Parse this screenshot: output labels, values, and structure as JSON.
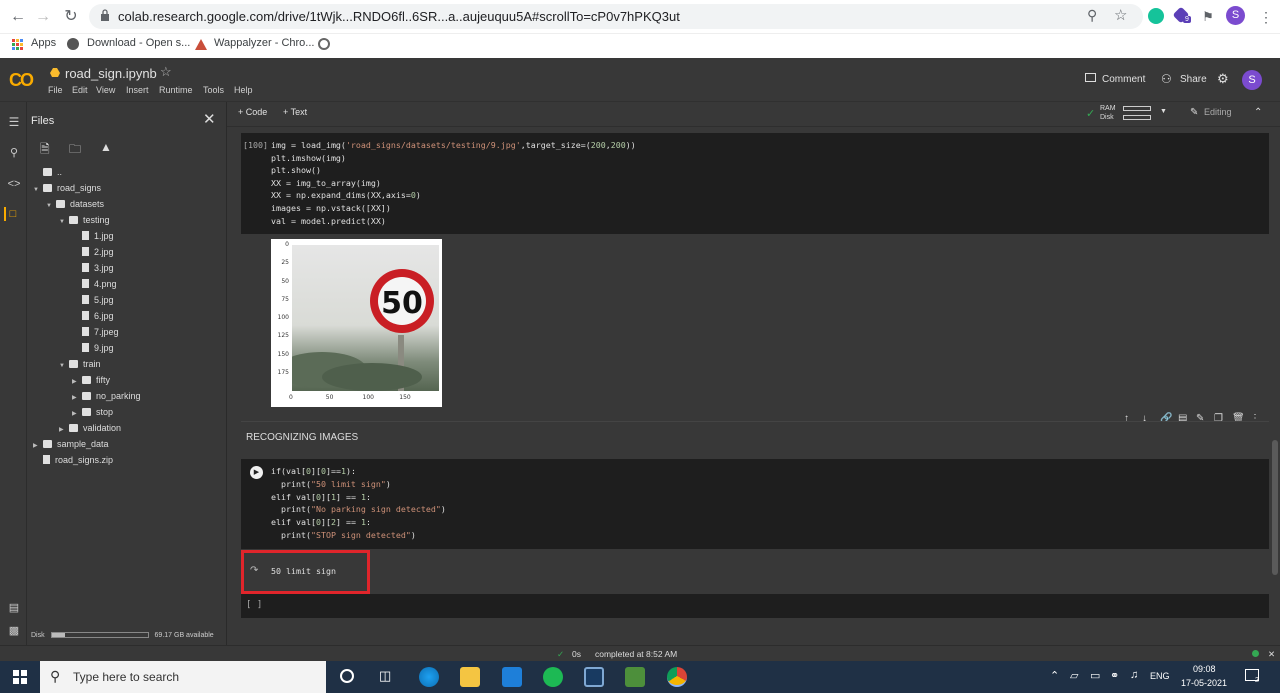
{
  "browser": {
    "url": "colab.research.google.com/drive/1tWjk...RNDO6fl..6SR...a..aujeuquu5A#scrollTo=cP0v7hPKQ3ut",
    "bookmarks": [
      {
        "label": "Apps"
      },
      {
        "label": "Download - Open s..."
      },
      {
        "label": "Wappalyzer - Chro..."
      }
    ],
    "profile_letter": "S",
    "extension_badge": "9"
  },
  "colab": {
    "logo": "CO",
    "notebook_title": "road_sign.ipynb",
    "menus": [
      "File",
      "Edit",
      "View",
      "Insert",
      "Runtime",
      "Tools",
      "Help"
    ],
    "comment_label": "Comment",
    "share_label": "Share",
    "avatar_letter": "S",
    "toolbar": {
      "add_code": "+ Code",
      "add_text": "+ Text",
      "ram_label": "RAM",
      "disk_label": "Disk",
      "editing_label": "Editing"
    }
  },
  "files": {
    "title": "Files",
    "tree": [
      {
        "label": "..",
        "kind": "folder-up",
        "depth": 0,
        "arrow": ""
      },
      {
        "label": "road_signs",
        "kind": "folder",
        "depth": 0,
        "arrow": "down"
      },
      {
        "label": "datasets",
        "kind": "folder",
        "depth": 1,
        "arrow": "down"
      },
      {
        "label": "testing",
        "kind": "folder",
        "depth": 2,
        "arrow": "down"
      },
      {
        "label": "1.jpg",
        "kind": "file",
        "depth": 3,
        "arrow": ""
      },
      {
        "label": "2.jpg",
        "kind": "file",
        "depth": 3,
        "arrow": ""
      },
      {
        "label": "3.jpg",
        "kind": "file",
        "depth": 3,
        "arrow": ""
      },
      {
        "label": "4.png",
        "kind": "file",
        "depth": 3,
        "arrow": ""
      },
      {
        "label": "5.jpg",
        "kind": "file",
        "depth": 3,
        "arrow": ""
      },
      {
        "label": "6.jpg",
        "kind": "file",
        "depth": 3,
        "arrow": ""
      },
      {
        "label": "7.jpeg",
        "kind": "file",
        "depth": 3,
        "arrow": ""
      },
      {
        "label": "9.jpg",
        "kind": "file",
        "depth": 3,
        "arrow": ""
      },
      {
        "label": "train",
        "kind": "folder",
        "depth": 2,
        "arrow": "down"
      },
      {
        "label": "fifty",
        "kind": "folder",
        "depth": 3,
        "arrow": "right"
      },
      {
        "label": "no_parking",
        "kind": "folder",
        "depth": 3,
        "arrow": "right"
      },
      {
        "label": "stop",
        "kind": "folder",
        "depth": 3,
        "arrow": "right"
      },
      {
        "label": "validation",
        "kind": "folder",
        "depth": 2,
        "arrow": "right"
      },
      {
        "label": "sample_data",
        "kind": "folder",
        "depth": 0,
        "arrow": "right"
      },
      {
        "label": "road_signs.zip",
        "kind": "file",
        "depth": 0,
        "arrow": ""
      }
    ],
    "disk_label": "Disk",
    "disk_used_fraction": 0.14,
    "disk_available": "69.17 GB available"
  },
  "cells": {
    "cell1": {
      "exec_count": "[100]",
      "lines": [
        "img = load_img('road_signs/datasets/testing/9.jpg',target_size=(200,200))",
        "plt.imshow(img)",
        "plt.show()",
        "XX = img_to_array(img)",
        "XX = np.expand_dims(XX,axis=0)",
        "images = np.vstack([XX])",
        "val = model.predict(XX)"
      ],
      "plot": {
        "sign_text": "50",
        "y_ticks": [
          "0",
          "25",
          "50",
          "75",
          "100",
          "125",
          "150",
          "175"
        ],
        "x_ticks": [
          "0",
          "50",
          "100",
          "150"
        ]
      }
    },
    "text_heading": "RECOGNIZING IMAGES",
    "cell2": {
      "lines": [
        "if(val[0][0]==1):",
        "  print(\"50 limit sign\")",
        "elif val[0][1] == 1:",
        "  print(\"No parking sign detected\")",
        "elif val[0][2] == 1:",
        "  print(\"STOP sign detected\")"
      ],
      "output": "50 limit sign"
    },
    "empty_cell": "[ ]"
  },
  "status": {
    "check": "✓",
    "duration": "0s",
    "completed": "completed at 8:52 AM"
  },
  "taskbar": {
    "search_placeholder": "Type here to search",
    "lang": "ENG",
    "time": "09:08",
    "date": "17-05-2021",
    "notif_count": "2"
  }
}
